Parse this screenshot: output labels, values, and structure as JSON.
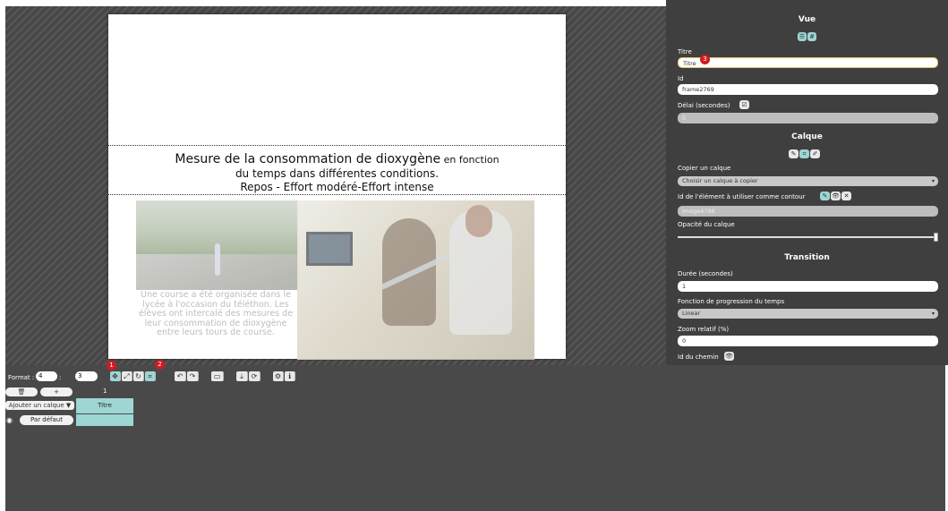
{
  "slide": {
    "title_main": "Mesure de la consommation de dioxygène",
    "title_suffix": " en fonction",
    "title_line2": "du temps  dans différentes conditions.",
    "title_line3": "Repos - Effort modéré-Effort intense",
    "caption": "Une course a été organisée dans le lycée à l'occasion du téléthon. Les élèves ont intercalé des mesures de leur consommation de dioxygène entre leurs tours de course."
  },
  "toolbar": {
    "format_label": "Format :",
    "format_width": "4",
    "format_sep": ":",
    "format_height": "3",
    "icons": {
      "move": "✥",
      "resize": "⤢",
      "rotate": "↻",
      "crop": "⌗",
      "undo": "↶",
      "redo": "↷",
      "preview": "▭",
      "download": "⤓",
      "refresh": "⟳",
      "settings": "⚙",
      "info": "ℹ"
    },
    "badges": [
      "1",
      "2",
      "3"
    ]
  },
  "timeline": {
    "delete_label": "🗑",
    "add_label": "+",
    "add_layer_label": "Ajouter un calque",
    "dropdown_arrow": "▼",
    "column_number": "1",
    "column_title": "Titre",
    "eye_icon": "◉",
    "layer_name": "Par défaut"
  },
  "panel": {
    "vue_heading": "Vue",
    "view_icons": [
      "☰",
      "#"
    ],
    "titre_label": "Titre",
    "titre_value": "Titre",
    "id_label": "Id",
    "id_value": "frame2769",
    "delai_label": "Délai (secondes)",
    "delai_value": "0",
    "check_icon": "☑",
    "calque_heading": "Calque",
    "calque_icons": [
      "✎",
      "⌗",
      "✐"
    ],
    "copier_label": "Copier un calque",
    "copier_value": "Choisir un calque à copier",
    "contour_label": "Id de l'élément à utiliser comme contour",
    "contour_icons": [
      "✎",
      "👁",
      "✕"
    ],
    "contour_value": "image4796",
    "opacite_label": "Opacité du calque",
    "opacite_value": 1.0,
    "transition_heading": "Transition",
    "duree_label": "Durée (secondes)",
    "duree_value": "1",
    "fonction_label": "Fonction de progression du temps",
    "fonction_value": "Linear",
    "zoom_label": "Zoom relatif (%)",
    "zoom_value": "0",
    "chemin_label": "Id du chemin",
    "chemin_icon": "👁",
    "select_arrow": "▾"
  }
}
